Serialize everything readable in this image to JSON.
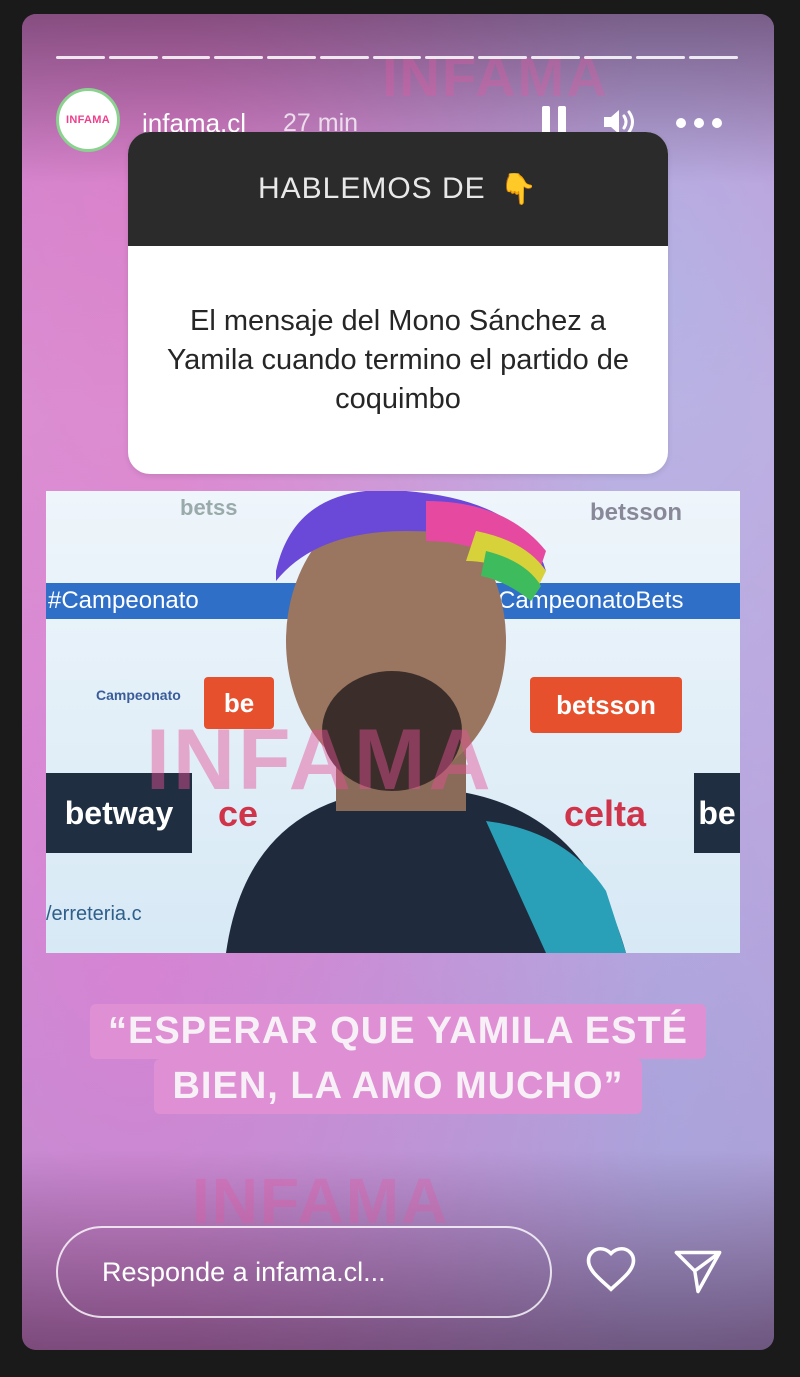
{
  "header": {
    "avatar_text": "INFAMA",
    "username": "infama.cl",
    "time_ago": "27 min",
    "icons": [
      "pause-icon",
      "volume-icon",
      "more-icon"
    ]
  },
  "progress": {
    "segments": 13
  },
  "question_sticker": {
    "heading": "HABLEMOS DE",
    "heading_emoji": "👇",
    "text": "El mensaje del Mono Sánchez a Yamila cuando termino el partido de coquimbo"
  },
  "photo": {
    "banner_left": "#Campeonato",
    "banner_right": "CampeonatoBets",
    "sponsor_betsson_top_left": "betss",
    "sponsor_betsson_top_right": "betsson",
    "sponsor_campeonato": "Campeonato",
    "sponsor_bet_mid": "be",
    "sponsor_betsson_mid": "betsson",
    "sponsor_betway": "betway",
    "sponsor_celta_left": "ce",
    "sponsor_celta_right": "celta",
    "sponsor_be_right": "be",
    "sponsor_ferreteria": "/erreteria.c",
    "watermark": "INFAMA"
  },
  "quote": {
    "line1": "“ESPERAR QUE YAMILA ESTÉ",
    "line2": "BIEN, LA AMO MUCHO”"
  },
  "reply": {
    "placeholder": "Responde a infama.cl..."
  },
  "watermark_text": "INFAMA",
  "colors": {
    "background": "#1a1a1a",
    "question_header": "#2b2b2b",
    "quote_highlight": "#df8fd3",
    "brand_pink": "#ef3f8c"
  }
}
